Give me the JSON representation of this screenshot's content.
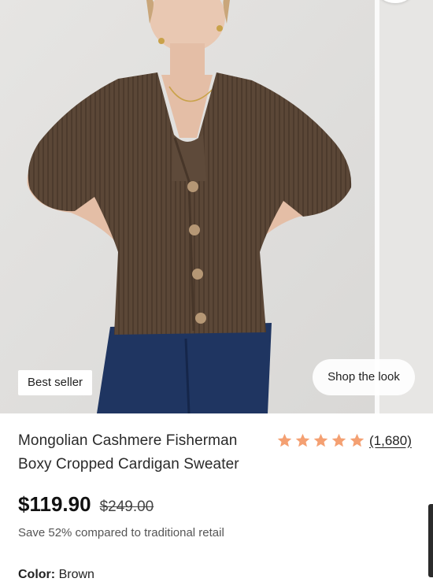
{
  "product": {
    "badge": "Best seller",
    "shop_the_look": "Shop the look",
    "title_line1": "Mongolian Cashmere Fisherman",
    "title_line2": "Boxy Cropped Cardigan Sweater",
    "rating_value": 5,
    "rating_count": "(1,680)",
    "price": "$119.90",
    "original_price": "$249.00",
    "savings": "Save 52% compared to traditional retail",
    "color_label": "Color:",
    "color_value": "Brown"
  },
  "colors": {
    "star": "#f4a072",
    "cardigan": "#5a4636",
    "jeans": "#1f3561",
    "background": "#e2e1df"
  }
}
